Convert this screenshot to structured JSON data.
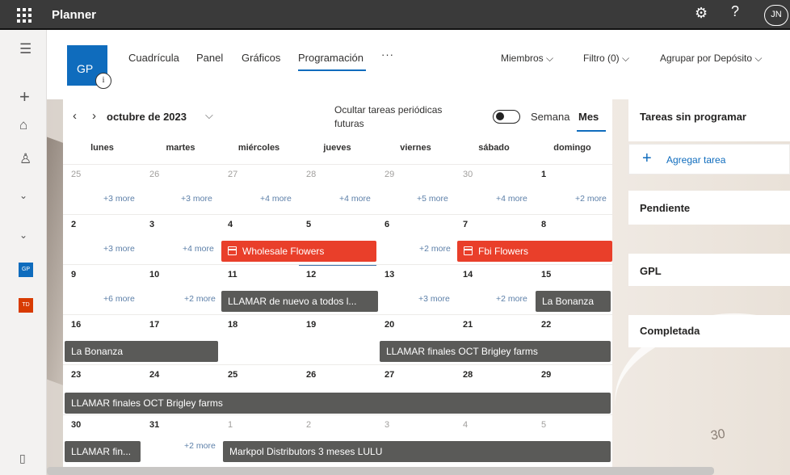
{
  "topbar": {
    "app_name": "Planner",
    "icons": [
      "waffle-icon",
      "gear-icon",
      "help-icon"
    ],
    "avatar": "JN"
  },
  "rail": {
    "icons": [
      "hamburger-icon",
      "plus-icon",
      "home-icon",
      "person-icon",
      "chevron-down-icon",
      "chevron-down-icon",
      "phone-icon"
    ],
    "tiles": [
      {
        "label": "GP",
        "color": "#0f6cbd"
      },
      {
        "label": "TD",
        "color": "#d83b01"
      }
    ]
  },
  "plan": {
    "initials": "GP",
    "info_glyph": "i",
    "tabs": [
      "Cuadrícula",
      "Panel",
      "Gráficos",
      "Programación"
    ],
    "active_tab": "Programación",
    "more": "···",
    "members": "Miembros",
    "filter": "Filtro (0)",
    "group_by": "Agrupar por Depósito"
  },
  "calendar": {
    "month_label": "octubre de 2023",
    "hide_recurring": "Ocultar tareas periódicas futuras",
    "view_week": "Semana",
    "view_month": "Mes",
    "day_headers": [
      "lunes",
      "martes",
      "miércoles",
      "jueves",
      "viernes",
      "sábado",
      "domingo"
    ],
    "weeks": [
      {
        "days": [
          "25",
          "26",
          "27",
          "28",
          "29",
          "30",
          "1"
        ],
        "more": [
          "+3 more",
          "+3 more",
          "+4 more",
          "+4 more",
          "+5 more",
          "+4 more",
          "+2 more"
        ]
      },
      {
        "days": [
          "2",
          "3",
          "4",
          "5",
          "6",
          "7",
          "8"
        ],
        "more": [
          "+3 more",
          "+4 more",
          "+2 more"
        ]
      },
      {
        "days": [
          "9",
          "10",
          "11",
          "12",
          "13",
          "14",
          "15"
        ],
        "more": [
          "+6 more",
          "+2 more",
          "+3 more",
          "+2 more"
        ]
      },
      {
        "days": [
          "16",
          "17",
          "18",
          "19",
          "20",
          "21",
          "22"
        ]
      },
      {
        "days": [
          "23",
          "24",
          "25",
          "26",
          "27",
          "28",
          "29"
        ]
      },
      {
        "days": [
          "30",
          "31",
          "1",
          "2",
          "3",
          "4",
          "5"
        ],
        "more": [
          "+2 more"
        ]
      }
    ],
    "events": {
      "wholesale": "Wholesale Flowers",
      "fbi": "Fbi Flowers",
      "llamar_todos": "LLAMAR de nuevo a todos l...",
      "bonanza_15": "La Bonanza",
      "bonanza_16": "La Bonanza",
      "brigley_20": "LLAMAR finales OCT Brigley farms",
      "brigley_23": "LLAMAR finales OCT Brigley farms",
      "llamar_fin": "LLAMAR fin...",
      "markpol": "Markpol Distributors 3 meses LULU"
    },
    "colors": {
      "event_red": "#e93f2a",
      "event_grey": "#5a5a58",
      "accent": "#0f6cbd"
    }
  },
  "side_panel": {
    "unscheduled_title": "Tareas sin programar",
    "add_task": "Agregar tarea",
    "buckets": [
      "Pendiente",
      "GPL",
      "Completada"
    ]
  },
  "background": {
    "number": "30"
  }
}
